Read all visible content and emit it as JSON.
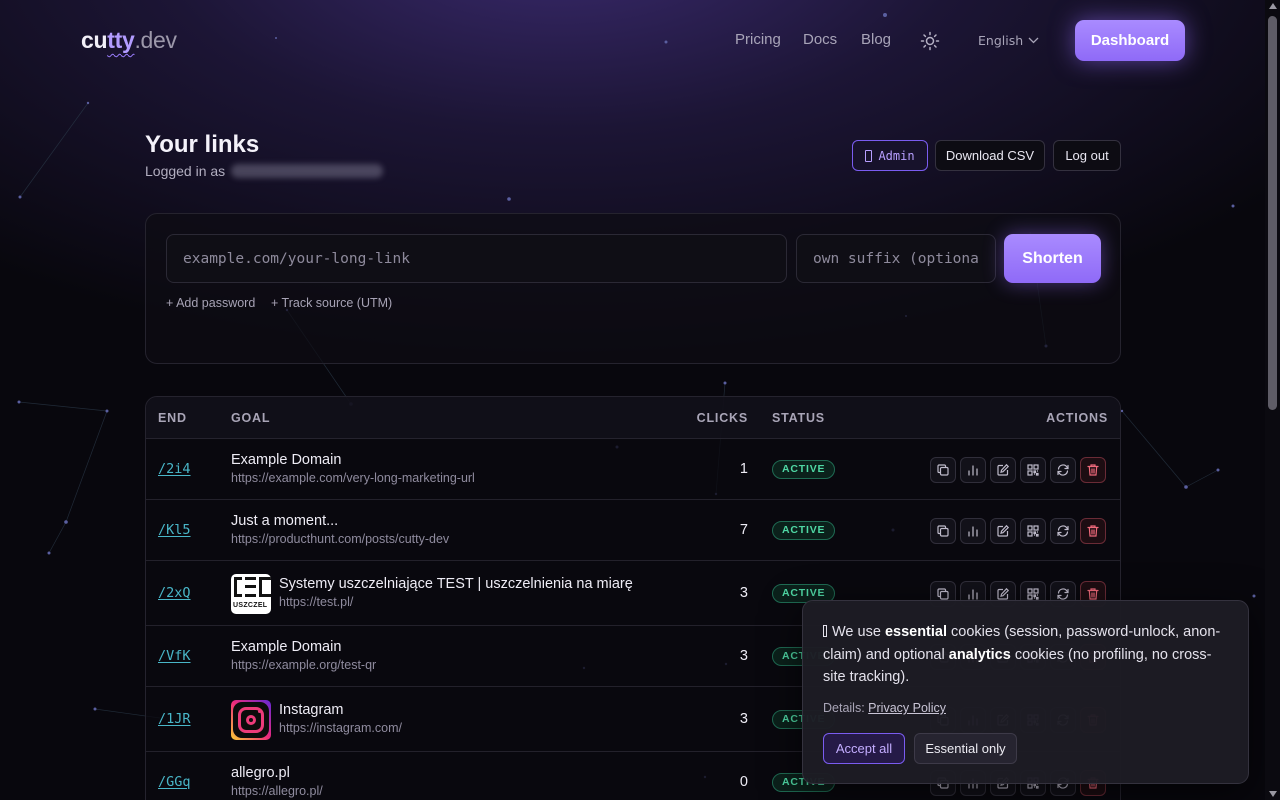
{
  "header": {
    "logo": {
      "pre": "cu",
      "mid": "tty",
      "tld": ".dev"
    },
    "nav": [
      "Pricing",
      "Docs",
      "Blog"
    ],
    "language": "English",
    "dashboard_label": "Dashboard"
  },
  "links_section": {
    "title": "Your links",
    "logged_in_label": "Logged in as",
    "admin_label": "Admin",
    "download_csv_label": "Download CSV",
    "logout_label": "Log out"
  },
  "shorten_form": {
    "url_placeholder": "example.com/your-long-link",
    "suffix_placeholder": "own suffix (optional)",
    "shorten_label": "Shorten",
    "add_password_label": "+ Add password",
    "track_source_label": "+ Track source (UTM)"
  },
  "table": {
    "headers": {
      "end": "END",
      "goal": "GOAL",
      "clicks": "CLICKS",
      "status": "STATUS",
      "actions": "ACTIONS"
    },
    "rows": [
      {
        "end": "/2i4",
        "title": "Example Domain",
        "url": "https://example.com/very-long-marketing-url",
        "clicks": "1",
        "status": "ACTIVE",
        "favicon": ""
      },
      {
        "end": "/Kl5",
        "title": "Just a moment...",
        "url": "https://producthunt.com/posts/cutty-dev",
        "clicks": "7",
        "status": "ACTIVE",
        "favicon": ""
      },
      {
        "end": "/2xQ",
        "title": "Systemy uszczelniające TEST | uszczelnienia na miarę",
        "url": "https://test.pl/",
        "clicks": "3",
        "status": "ACTIVE",
        "favicon": "test-logo"
      },
      {
        "end": "/VfK",
        "title": "Example Domain",
        "url": "https://example.org/test-qr",
        "clicks": "3",
        "status": "ACTIVE",
        "favicon": ""
      },
      {
        "end": "/1JR",
        "title": "Instagram",
        "url": "https://instagram.com/",
        "clicks": "3",
        "status": "ACTIVE",
        "favicon": "instagram-logo"
      },
      {
        "end": "/GGq",
        "title": "allegro.pl",
        "url": "https://allegro.pl/",
        "clicks": "0",
        "status": "ACTIVE",
        "favicon": ""
      }
    ],
    "action_icons": [
      "copy-icon",
      "stats-icon",
      "edit-icon",
      "qr-icon",
      "refresh-icon",
      "trash-icon"
    ],
    "favicon_test_text": "USZCZEL"
  },
  "cookie_banner": {
    "t1": "We use ",
    "b1": "essential",
    "t2": " cookies (session, password-unlock, anon-claim) and optional ",
    "b2": "analytics",
    "t3": " cookies (no profiling, no cross-site tracking).",
    "details_label": "Details:",
    "privacy_link": "Privacy Policy",
    "accept_label": "Accept all",
    "essential_label": "Essential only"
  },
  "colors": {
    "accent": "#9b7dff",
    "active": "#4fd7a4",
    "link": "#49b6c8",
    "danger": "#f06a7b"
  }
}
